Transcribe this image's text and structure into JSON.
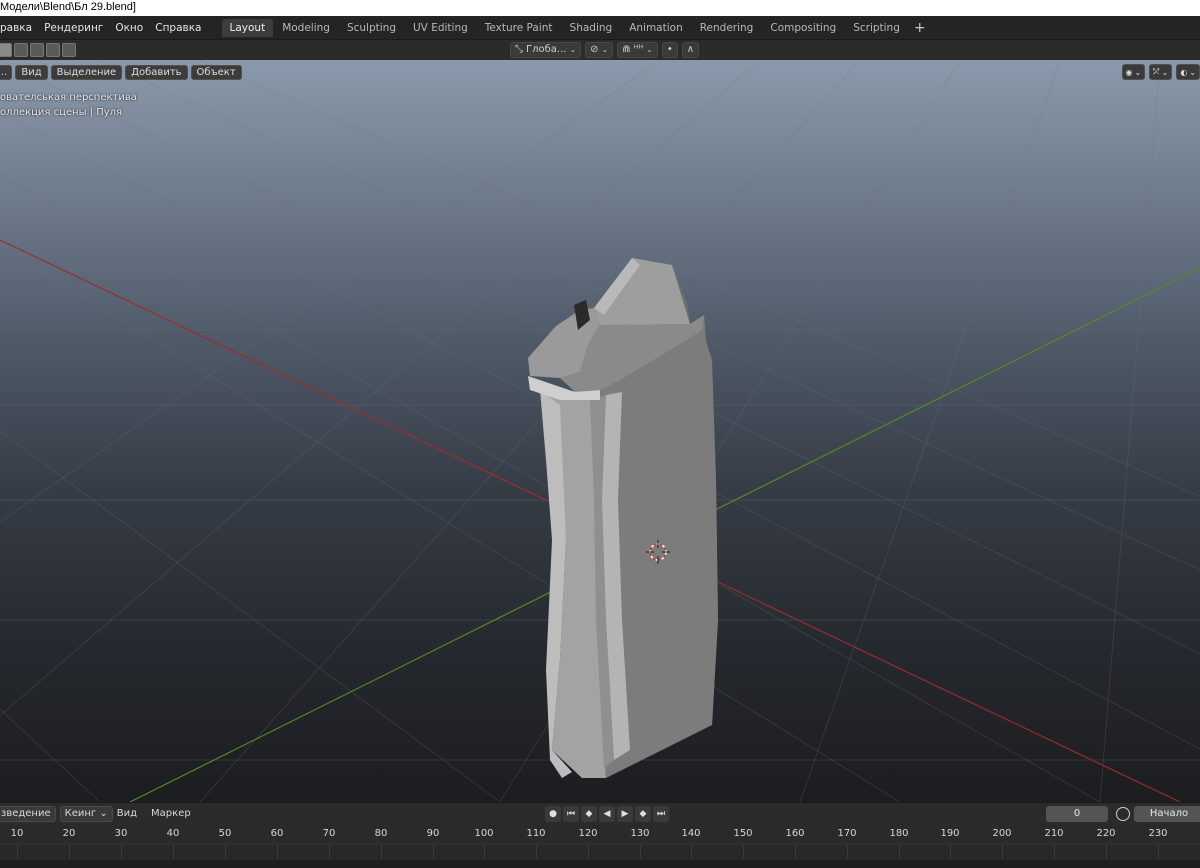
{
  "window": {
    "title": "Модели\\Blend\\Бл 29.blend]"
  },
  "menu": [
    "равка",
    "Рендеринг",
    "Окно",
    "Справка"
  ],
  "workspaces": [
    "Layout",
    "Modeling",
    "Sculpting",
    "UV Editing",
    "Texture Paint",
    "Shading",
    "Animation",
    "Rendering",
    "Compositing",
    "Scripting"
  ],
  "active_workspace": "Layout",
  "workspace_add": "+",
  "tool_header": {
    "transform_orientation": "Глоба...",
    "snap_label": "ᴴᴴ"
  },
  "viewport": {
    "header_buttons": [
      "..",
      "Вид",
      "Выделение",
      "Добавить",
      "Объект"
    ],
    "info_line1": "ователськая перспектива",
    "info_line2": "оллекция сцены | Пуля",
    "colors": {
      "x_axis": "#9b2d2d",
      "y_axis": "#4f8a2a",
      "object": "#8a8a8a"
    }
  },
  "timeline": {
    "left_buttons": [
      "зведение",
      "Кеинг"
    ],
    "view_label": "Вид",
    "marker_label": "Маркер",
    "current_frame": "0",
    "start_label": "Начало",
    "ticks": [
      "10",
      "20",
      "30",
      "40",
      "50",
      "60",
      "70",
      "80",
      "90",
      "100",
      "110",
      "120",
      "130",
      "140",
      "150",
      "160",
      "170",
      "180",
      "190",
      "200",
      "210",
      "220",
      "230"
    ]
  }
}
